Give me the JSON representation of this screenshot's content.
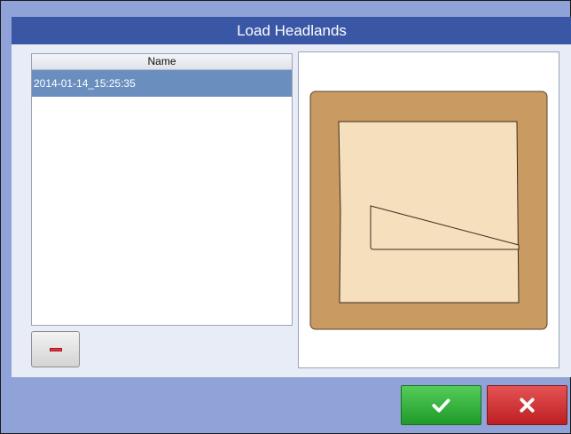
{
  "dialog": {
    "title": "Load Headlands"
  },
  "list": {
    "column_header": "Name",
    "items": [
      {
        "name": "2014-01-14_15:25:35",
        "selected": true
      }
    ]
  },
  "buttons": {
    "remove_icon": "minus-icon",
    "ok_icon": "checkmark-icon",
    "cancel_icon": "x-icon"
  },
  "colors": {
    "title_bar": "#3a57a6",
    "footer": "#8fa3d8",
    "selection": "#6a8fbf",
    "headland_outer": "#c99a62",
    "field_inner": "#f6dfbc",
    "ok": "#2aa832",
    "cancel": "#d23234"
  }
}
